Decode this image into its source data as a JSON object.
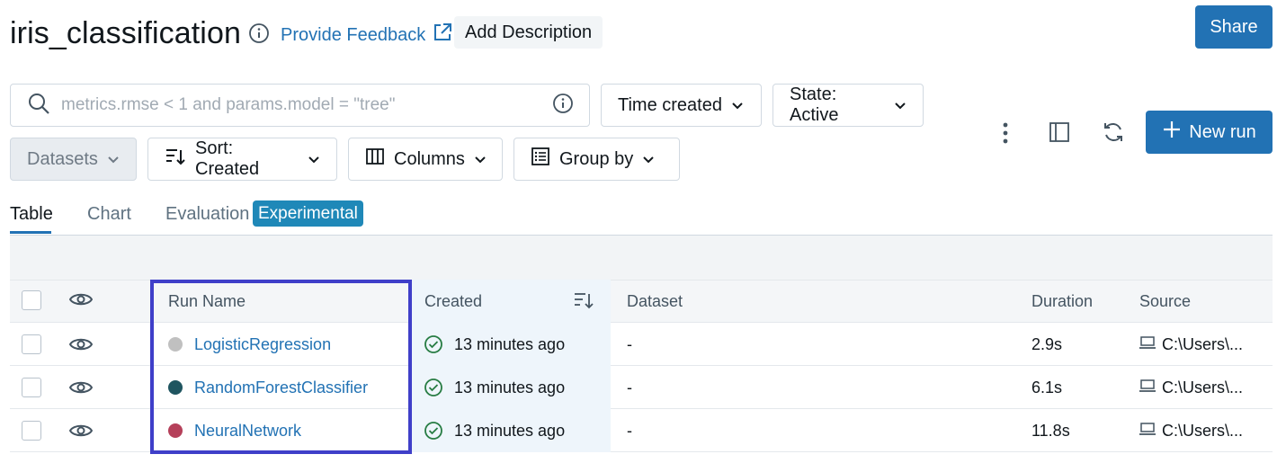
{
  "header": {
    "title": "iris_classification",
    "feedback_label": "Provide Feedback",
    "add_description_label": "Add Description",
    "share_label": "Share"
  },
  "filters": {
    "search_placeholder": "metrics.rmse < 1 and params.model = \"tree\"",
    "time_created_label": "Time created",
    "state_label": "State: Active",
    "datasets_label": "Datasets",
    "sort_label": "Sort: Created",
    "columns_label": "Columns",
    "group_by_label": "Group by"
  },
  "toolbar": {
    "new_run_label": "New run"
  },
  "tabs": [
    {
      "label": "Table"
    },
    {
      "label": "Chart"
    },
    {
      "label": "Evaluation"
    }
  ],
  "experimental_badge": "Experimental",
  "table": {
    "headers": {
      "run_name": "Run Name",
      "created": "Created",
      "dataset": "Dataset",
      "duration": "Duration",
      "source": "Source"
    },
    "rows": [
      {
        "run_name": "LogisticRegression",
        "color": "#c0c0c0",
        "created": "13 minutes ago",
        "dataset": "-",
        "duration": "2.9s",
        "source": "C:\\Users\\..."
      },
      {
        "run_name": "RandomForestClassifier",
        "color": "#1f5560",
        "created": "13 minutes ago",
        "dataset": "-",
        "duration": "6.1s",
        "source": "C:\\Users\\..."
      },
      {
        "run_name": "NeuralNetwork",
        "color": "#b5405a",
        "created": "13 minutes ago",
        "dataset": "-",
        "duration": "11.8s",
        "source": "C:\\Users\\..."
      }
    ]
  },
  "colors": {
    "accent": "#2272b4",
    "highlight_box": "#3f3fc9",
    "success": "#277c43"
  }
}
